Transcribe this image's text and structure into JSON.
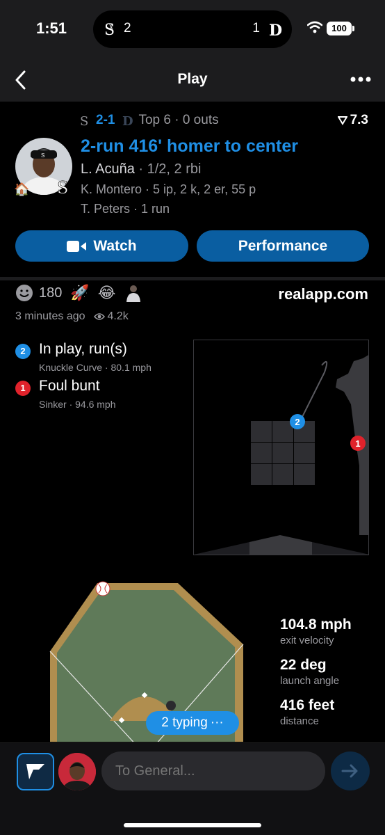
{
  "status": {
    "time": "1:51",
    "battery": "100",
    "score_left": "2",
    "score_right": "1"
  },
  "nav": {
    "title": "Play"
  },
  "play": {
    "score": "2-1",
    "inning": "Top 6 · 0 outs",
    "win_prob": "7.3",
    "headline": "2-run 416' homer to center",
    "batter": "L. Acuña",
    "batter_stats": " · 1/2, 2 rbi",
    "pitcher_line": "K. Montero · 5 ip, 2 k, 2 er, 55 p",
    "runner_line": "T. Peters · 1 run"
  },
  "buttons": {
    "watch": "Watch",
    "performance": "Performance"
  },
  "reactions": {
    "count": "180",
    "site": "realapp.com",
    "ago": "3 minutes ago",
    "views": "4.2k"
  },
  "pitches": [
    {
      "num": "2",
      "result": "In play, run(s)",
      "detail": "Knuckle Curve · 80.1 mph",
      "color": "#1f8fe5"
    },
    {
      "num": "1",
      "result": "Foul bunt",
      "detail": "Sinker · 94.6 mph",
      "color": "#e0222b"
    }
  ],
  "stats": [
    {
      "value": "104.8 mph",
      "label": "exit velocity"
    },
    {
      "value": "22 deg",
      "label": "launch angle"
    },
    {
      "value": "416 feet",
      "label": "distance"
    }
  ],
  "typing": {
    "label": "2 typing",
    "dots": "···"
  },
  "composer": {
    "placeholder": "To General..."
  }
}
